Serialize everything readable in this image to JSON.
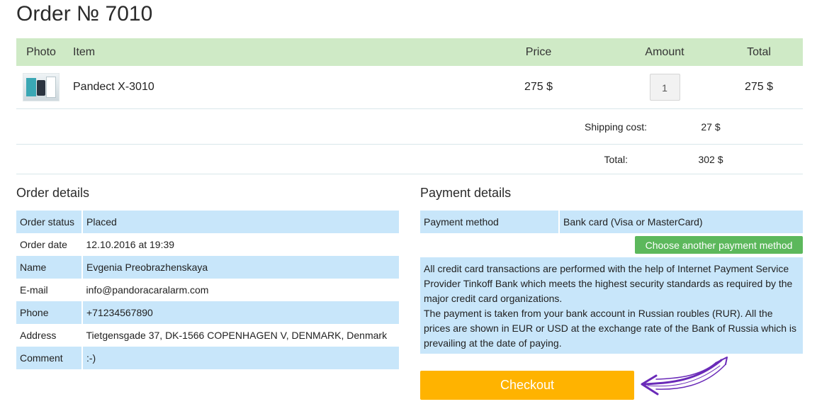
{
  "page": {
    "title": "Order № 7010"
  },
  "items_table": {
    "headers": {
      "photo": "Photo",
      "item": "Item",
      "price": "Price",
      "amount": "Amount",
      "total": "Total"
    },
    "rows": [
      {
        "photo_icon": "product-thumbnail",
        "item": "Pandect X-3010",
        "price": "275 $",
        "amount": "1",
        "total": "275 $"
      }
    ]
  },
  "summary": {
    "shipping_label": "Shipping cost:",
    "shipping_value": "27 $",
    "total_label": "Total:",
    "total_value": "302 $"
  },
  "order_details": {
    "title": "Order details",
    "rows": [
      {
        "label": "Order status",
        "value": "Placed"
      },
      {
        "label": "Order date",
        "value": "12.10.2016 at 19:39"
      },
      {
        "label": "Name",
        "value": "Evgenia Preobrazhenskaya"
      },
      {
        "label": "E-mail",
        "value": "info@pandoracaralarm.com"
      },
      {
        "label": "Phone",
        "value": "+71234567890"
      },
      {
        "label": "Address",
        "value": "Tietgensgade 37, DK-1566 COPENHAGEN V, DENMARK, Denmark"
      },
      {
        "label": "Comment",
        "value": ":-)"
      }
    ]
  },
  "payment_details": {
    "title": "Payment details",
    "method_label": "Payment method",
    "method_value": "Bank card (Visa or MasterCard)",
    "choose_button": "Choose another payment method",
    "note_line1": "All credit card transactions are performed with the help of Internet Payment Service Provider Tinkoff Bank which meets the highest security standards as required by the major credit card organizations.",
    "note_line2": "The payment is taken from your bank account in Russian roubles (RUR). All the prices are shown in EUR or USD at the exchange rate of the Bank of Russia which is prevailing at the date of paying."
  },
  "checkout": {
    "label": "Checkout"
  },
  "colors": {
    "header_bg": "#cfeac6",
    "row_bg": "#c8e6fa",
    "green_button": "#5cb85c",
    "checkout_button": "#ffb300",
    "arrow": "#6a2ab8"
  },
  "icons": {
    "arrow": "hand-drawn-arrow-icon"
  }
}
